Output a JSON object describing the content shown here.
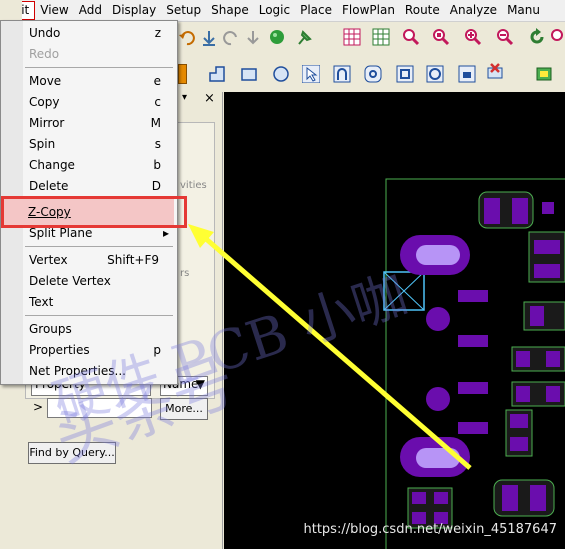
{
  "menubar": [
    "Edit",
    "View",
    "Add",
    "Display",
    "Setup",
    "Shape",
    "Logic",
    "Place",
    "FlowPlan",
    "Route",
    "Analyze",
    "Manu"
  ],
  "edit_menu": {
    "undo": {
      "label": "Undo",
      "shortcut": "z"
    },
    "redo": {
      "label": "Redo"
    },
    "move": {
      "label": "Move",
      "shortcut": "e"
    },
    "copy": {
      "label": "Copy",
      "shortcut": "c"
    },
    "mirror": {
      "label": "Mirror",
      "shortcut": "M"
    },
    "spin": {
      "label": "Spin",
      "shortcut": "s"
    },
    "change": {
      "label": "Change",
      "shortcut": "b"
    },
    "delete": {
      "label": "Delete",
      "shortcut": "D"
    },
    "zcopy": {
      "label": "Z-Copy"
    },
    "splitplane": {
      "label": "Split Plane",
      "arrow": "▸"
    },
    "vertex": {
      "label": "Vertex",
      "shortcut": "Shift+F9"
    },
    "deletevertex": {
      "label": "Delete Vertex"
    },
    "text": {
      "label": "Text"
    },
    "groups": {
      "label": "Groups"
    },
    "properties": {
      "label": "Properties",
      "shortcut": "p"
    },
    "netproperties": {
      "label": "Net Properties..."
    }
  },
  "panel": {
    "activities_fragment": "vities",
    "rs_fragment": "rs",
    "property_select": "Property",
    "name_select": "Name",
    "more_button": "More...",
    "find_button": "Find by Query...",
    "close_glyph": "×",
    "expander": ">"
  },
  "watermark": {
    "line1": "头条号",
    "line2": "硬件 PCB 小咖"
  },
  "footer_url": "https://blog.csdn.net/weixin_45187647",
  "colors": {
    "highlight": "#e53935",
    "arrow": "#ffff33",
    "pad": "#6a0dad",
    "pad_light": "#b794f6",
    "outline": "#4caf50",
    "canvas": "#000000"
  }
}
